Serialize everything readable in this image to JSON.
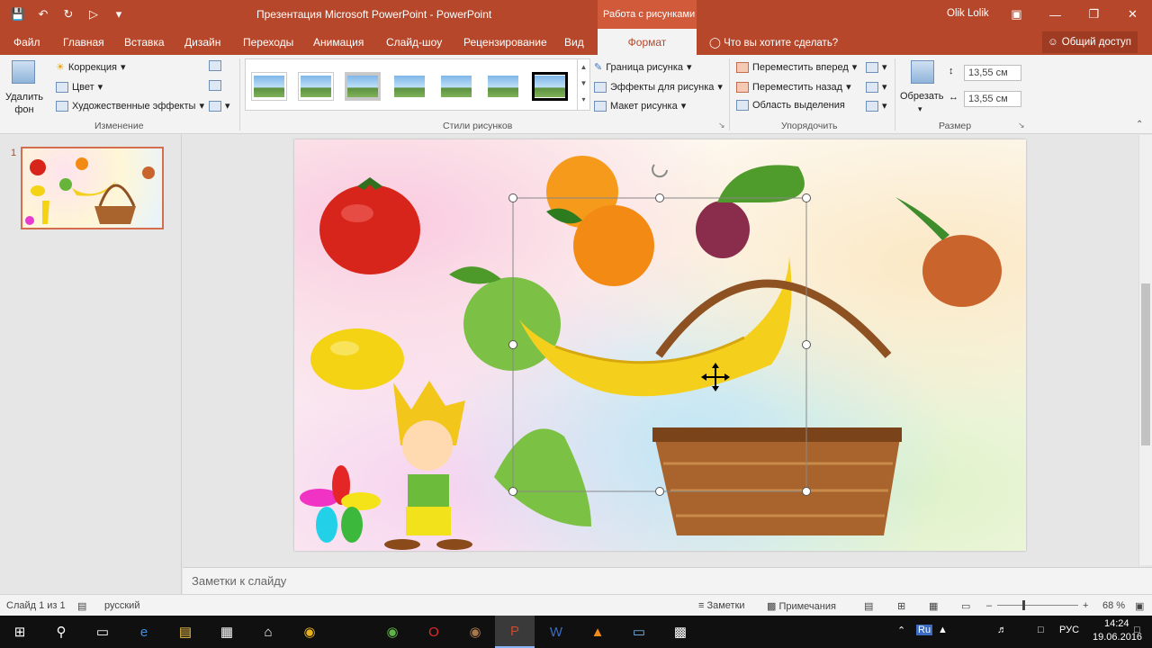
{
  "window": {
    "title": "Презентация Microsoft PowerPoint - PowerPoint",
    "context_tab_header": "Работа с рисунками",
    "user": "Olik Lolik"
  },
  "tabs": [
    "Файл",
    "Главная",
    "Вставка",
    "Дизайн",
    "Переходы",
    "Анимация",
    "Слайд-шоу",
    "Рецензирование",
    "Вид"
  ],
  "active_tab": "Формат",
  "tell_me": "Что вы хотите сделать?",
  "share": "Общий доступ",
  "ribbon": {
    "remove_bg": "Удалить фон",
    "correction": "Коррекция",
    "color": "Цвет",
    "art_effects": "Художественные эффекты",
    "group_adjust": "Изменение",
    "group_styles": "Стили рисунков",
    "border": "Граница рисунка",
    "effects": "Эффекты для рисунка",
    "layout": "Макет рисунка",
    "bring_forward": "Переместить вперед",
    "send_backward": "Переместить назад",
    "selection_pane": "Область выделения",
    "group_arrange": "Упорядочить",
    "crop": "Обрезать",
    "height": "13,55 см",
    "width": "13,55 см",
    "group_size": "Размер"
  },
  "slides": {
    "current_number": "1"
  },
  "notes_placeholder": "Заметки к слайду",
  "status": {
    "slide_info": "Слайд 1 из 1",
    "language": "русский",
    "notes_btn": "Заметки",
    "comments_btn": "Примечания",
    "zoom": "68 %"
  },
  "taskbar": {
    "lang": "РУС",
    "time": "14:24",
    "date": "19.06.2016",
    "ime": "Ru"
  },
  "colors": {
    "accent": "#b7472a"
  }
}
